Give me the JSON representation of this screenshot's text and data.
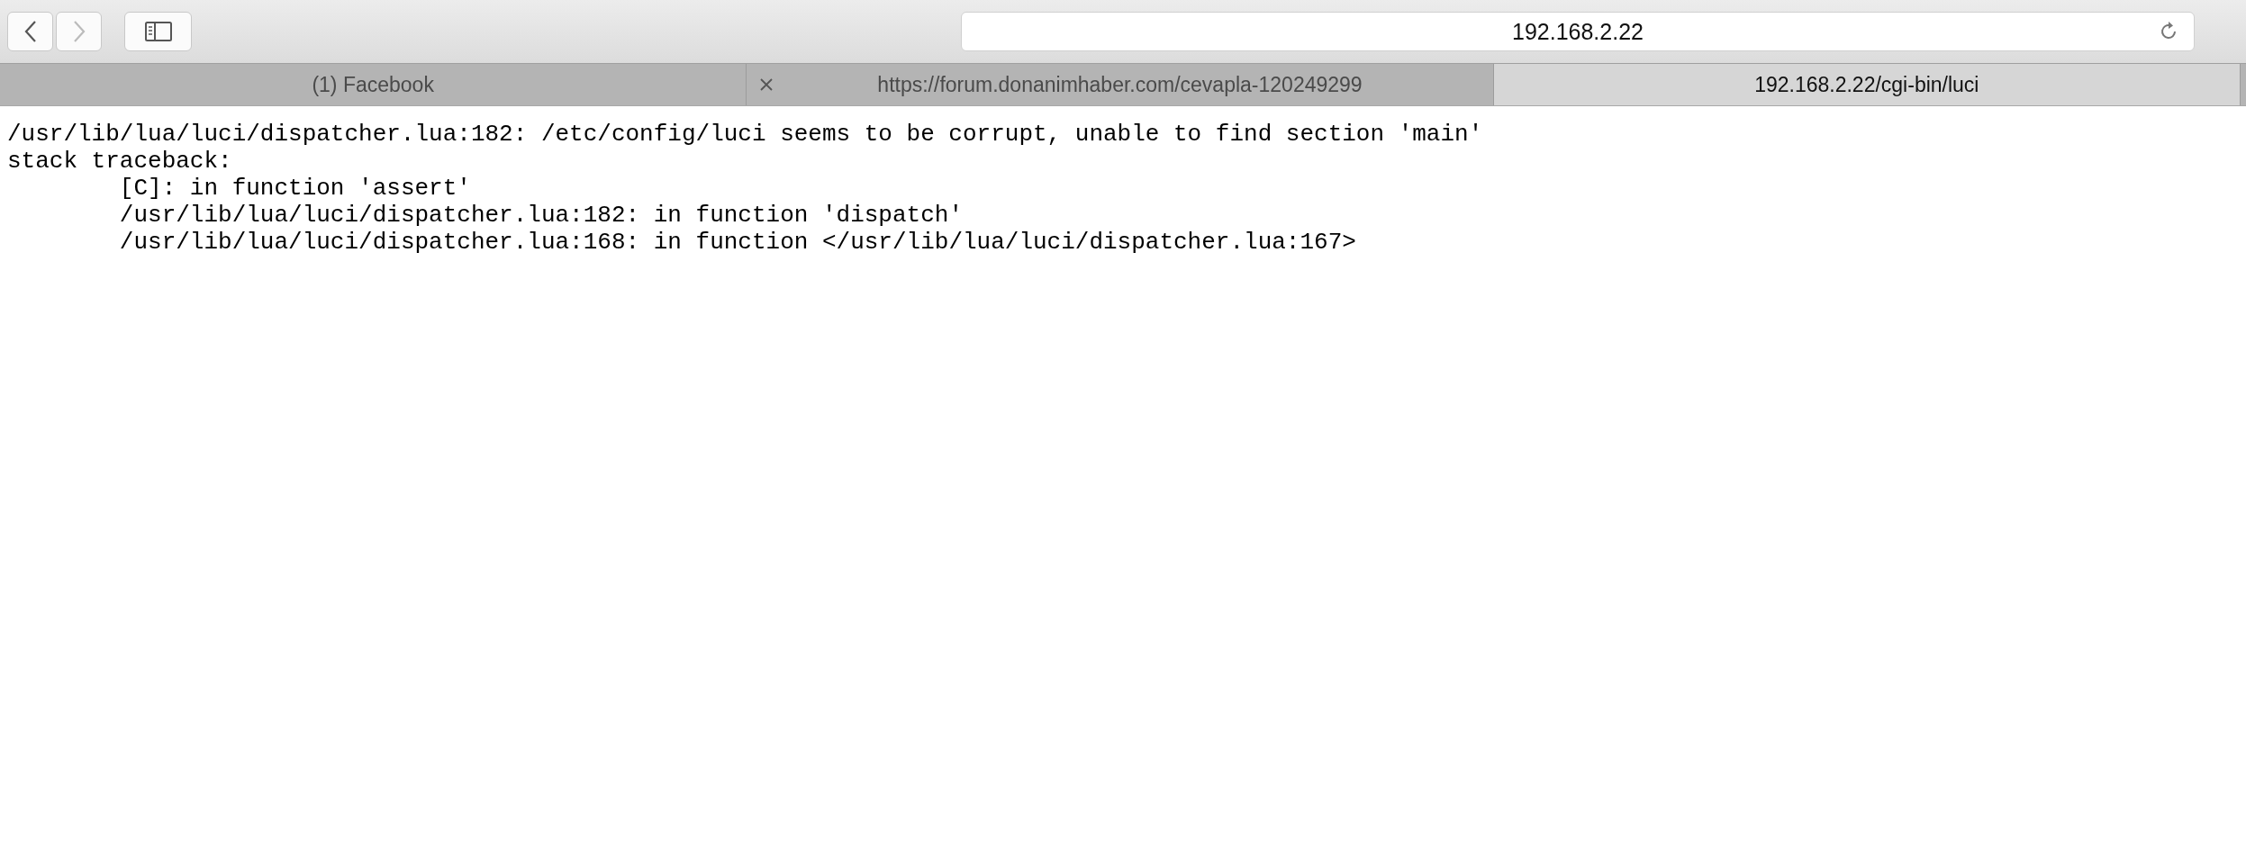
{
  "toolbar": {
    "address": "192.168.2.22"
  },
  "tabs": [
    {
      "label": "(1) Facebook",
      "selected": false,
      "show_close": false
    },
    {
      "label": "https://forum.donanimhaber.com/cevapla-120249299",
      "selected": false,
      "show_close": true
    },
    {
      "label": "192.168.2.22/cgi-bin/luci",
      "selected": true,
      "show_close": false
    }
  ],
  "page": {
    "lines": [
      "/usr/lib/lua/luci/dispatcher.lua:182: /etc/config/luci seems to be corrupt, unable to find section 'main'",
      "stack traceback:",
      "\t[C]: in function 'assert'",
      "\t/usr/lib/lua/luci/dispatcher.lua:182: in function 'dispatch'",
      "\t/usr/lib/lua/luci/dispatcher.lua:168: in function </usr/lib/lua/luci/dispatcher.lua:167>"
    ]
  }
}
